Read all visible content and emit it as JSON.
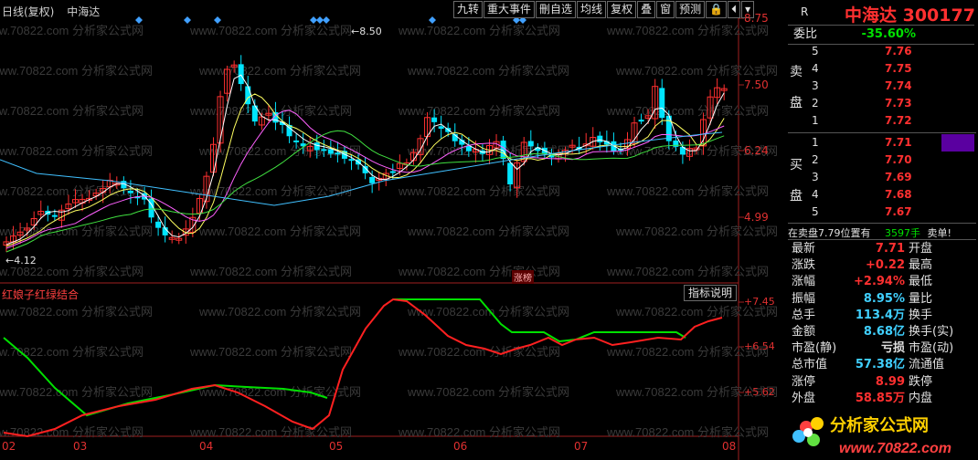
{
  "header": {
    "period": "日线(复权)",
    "stock_name": "中海达"
  },
  "toolbar": [
    "九转",
    "重大事件",
    "刪自选",
    "均线",
    "复权",
    "叠",
    "窗",
    "预测",
    "🔒",
    "⏴",
    "▾"
  ],
  "price_axis": [
    "8.75",
    "7.50",
    "6.24",
    "4.99"
  ],
  "annotations": {
    "high": "8.50",
    "low": "4.12",
    "event_badge": "涨榜"
  },
  "indicator": {
    "title": "红娘子红绿结合",
    "button": "指标说明",
    "axis": [
      "+7.45",
      "+6.54",
      "+5.62"
    ]
  },
  "date_axis": [
    "02",
    "03",
    "04",
    "05",
    "06",
    "07",
    "08"
  ],
  "watermark": "www.70822.com 分析家公式网",
  "colors": {
    "up": "#ff3030",
    "down": "#00e5ff",
    "green": "#00e000",
    "panel_accent": "#5a00a0"
  },
  "panel": {
    "symbol_badge": "R",
    "title": "中海达 300177",
    "weibi_label": "委比",
    "weibi_value": "-35.60%",
    "sell_label": [
      "卖",
      "盘"
    ],
    "buy_label": [
      "买",
      "盘"
    ],
    "sell_orders": [
      {
        "idx": "5",
        "price": "7.76"
      },
      {
        "idx": "4",
        "price": "7.75"
      },
      {
        "idx": "3",
        "price": "7.74"
      },
      {
        "idx": "2",
        "price": "7.73"
      },
      {
        "idx": "1",
        "price": "7.72"
      }
    ],
    "buy_orders": [
      {
        "idx": "1",
        "price": "7.71"
      },
      {
        "idx": "2",
        "price": "7.70"
      },
      {
        "idx": "3",
        "price": "7.69"
      },
      {
        "idx": "4",
        "price": "7.68"
      },
      {
        "idx": "5",
        "price": "7.67"
      }
    ],
    "note_a": "在卖盘7.79位置有",
    "note_b": "3597手",
    "note_c": "卖单!",
    "quotes": [
      {
        "label": "最新",
        "value": "7.71",
        "color": "#ff3030",
        "right": "开盘"
      },
      {
        "label": "涨跌",
        "value": "+0.22",
        "color": "#ff3030",
        "right": "最高"
      },
      {
        "label": "涨幅",
        "value": "+2.94%",
        "color": "#ff3030",
        "right": "最低"
      },
      {
        "label": "振幅",
        "value": "8.95%",
        "color": "#40d0ff",
        "right": "量比"
      },
      {
        "label": "总手",
        "value": "113.4万",
        "color": "#40d0ff",
        "right": "换手"
      },
      {
        "label": "金额",
        "value": "8.68亿",
        "color": "#40d0ff",
        "right": "换手(实)"
      },
      {
        "label": "市盈(静)",
        "value": "亏损",
        "color": "#e0e0e0",
        "right": "市盈(动)"
      },
      {
        "label": "总市值",
        "value": "57.38亿",
        "color": "#40d0ff",
        "right": "流通值"
      },
      {
        "label": "涨停",
        "value": "8.99",
        "color": "#ff3030",
        "right": "跌停"
      },
      {
        "label": "外盘",
        "value": "58.85万",
        "color": "#ff3030",
        "right": "内盘"
      }
    ],
    "logo_text": "分析家公式网",
    "logo_url": "www.70822.com"
  }
}
